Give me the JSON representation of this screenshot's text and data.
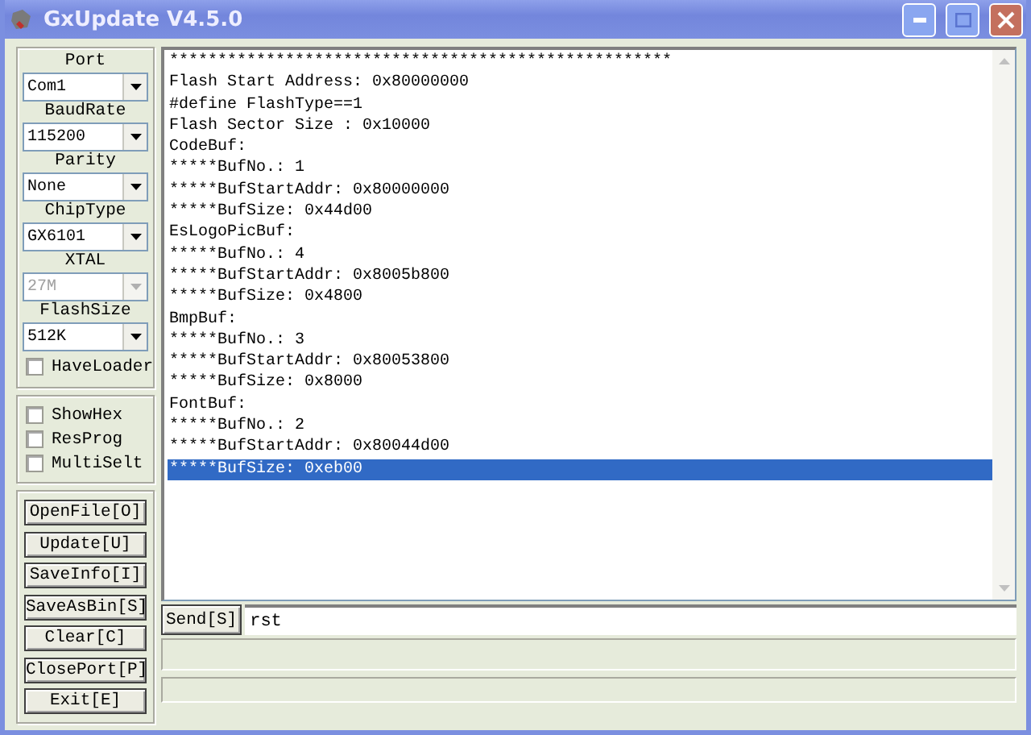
{
  "window": {
    "title": "GxUpdate V4.5.0"
  },
  "settings": [
    {
      "label": "Port",
      "value": "Com1",
      "disabled": false
    },
    {
      "label": "BaudRate",
      "value": "115200",
      "disabled": false
    },
    {
      "label": "Parity",
      "value": "None",
      "disabled": false
    },
    {
      "label": "ChipType",
      "value": "GX6101",
      "disabled": false
    },
    {
      "label": "XTAL",
      "value": "27M",
      "disabled": true
    },
    {
      "label": "FlashSize",
      "value": "512K",
      "disabled": false
    }
  ],
  "have_loader": {
    "label": "HaveLoader",
    "checked": false
  },
  "options": [
    {
      "label": "ShowHex",
      "checked": false
    },
    {
      "label": "ResProg",
      "checked": false
    },
    {
      "label": "MultiSelt",
      "checked": false
    }
  ],
  "buttons": [
    "OpenFile[O]",
    "Update[U]",
    "SaveInfo[I]",
    "SaveAsBin[S]",
    "Clear[C]",
    "ClosePort[P]",
    "Exit[E]"
  ],
  "log": [
    {
      "text": "****************************************************",
      "selected": false
    },
    {
      "text": "Flash Start Address: 0x80000000",
      "selected": false
    },
    {
      "text": "#define FlashType==1",
      "selected": false
    },
    {
      "text": "Flash Sector Size : 0x10000",
      "selected": false
    },
    {
      "text": "CodeBuf:",
      "selected": false
    },
    {
      "text": "*****BufNo.: 1",
      "selected": false
    },
    {
      "text": "*****BufStartAddr: 0x80000000",
      "selected": false
    },
    {
      "text": "*****BufSize: 0x44d00",
      "selected": false
    },
    {
      "text": "EsLogoPicBuf:",
      "selected": false
    },
    {
      "text": "*****BufNo.: 4",
      "selected": false
    },
    {
      "text": "*****BufStartAddr: 0x8005b800",
      "selected": false
    },
    {
      "text": "*****BufSize: 0x4800",
      "selected": false
    },
    {
      "text": "BmpBuf:",
      "selected": false
    },
    {
      "text": "*****BufNo.: 3",
      "selected": false
    },
    {
      "text": "*****BufStartAddr: 0x80053800",
      "selected": false
    },
    {
      "text": "*****BufSize: 0x8000",
      "selected": false
    },
    {
      "text": "FontBuf:",
      "selected": false
    },
    {
      "text": "*****BufNo.: 2",
      "selected": false
    },
    {
      "text": "*****BufStartAddr: 0x80044d00",
      "selected": false
    },
    {
      "text": "*****BufSize: 0xeb00",
      "selected": true
    }
  ],
  "send": {
    "button": "Send[S]",
    "value": "rst"
  }
}
